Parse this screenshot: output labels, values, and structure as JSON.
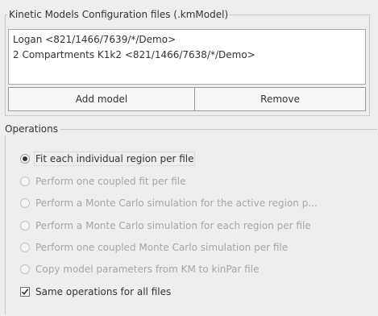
{
  "km_group": {
    "title": "Kinetic Models Configuration files (.kmModel)",
    "models": [
      "Logan <821/1466/7639/*/Demo>",
      "2 Compartments K1k2 <821/1466/7638/*/Demo>"
    ],
    "add_label": "Add model",
    "remove_label": "Remove"
  },
  "operations": {
    "title": "Operations",
    "options": [
      {
        "label": "Fit each individual region per file",
        "selected": true,
        "enabled": true
      },
      {
        "label": "Perform one coupled fit per file",
        "selected": false,
        "enabled": false
      },
      {
        "label": "Perform a Monte Carlo simulation for the active region p...",
        "selected": false,
        "enabled": false
      },
      {
        "label": "Perform a Monte Carlo simulation for each region per file",
        "selected": false,
        "enabled": false
      },
      {
        "label": "Perform one coupled Monte Carlo simulation per file",
        "selected": false,
        "enabled": false
      },
      {
        "label": "Copy model parameters from KM to kinPar file",
        "selected": false,
        "enabled": false
      }
    ],
    "same_ops_label": "Same operations for all files",
    "same_ops_checked": true
  }
}
